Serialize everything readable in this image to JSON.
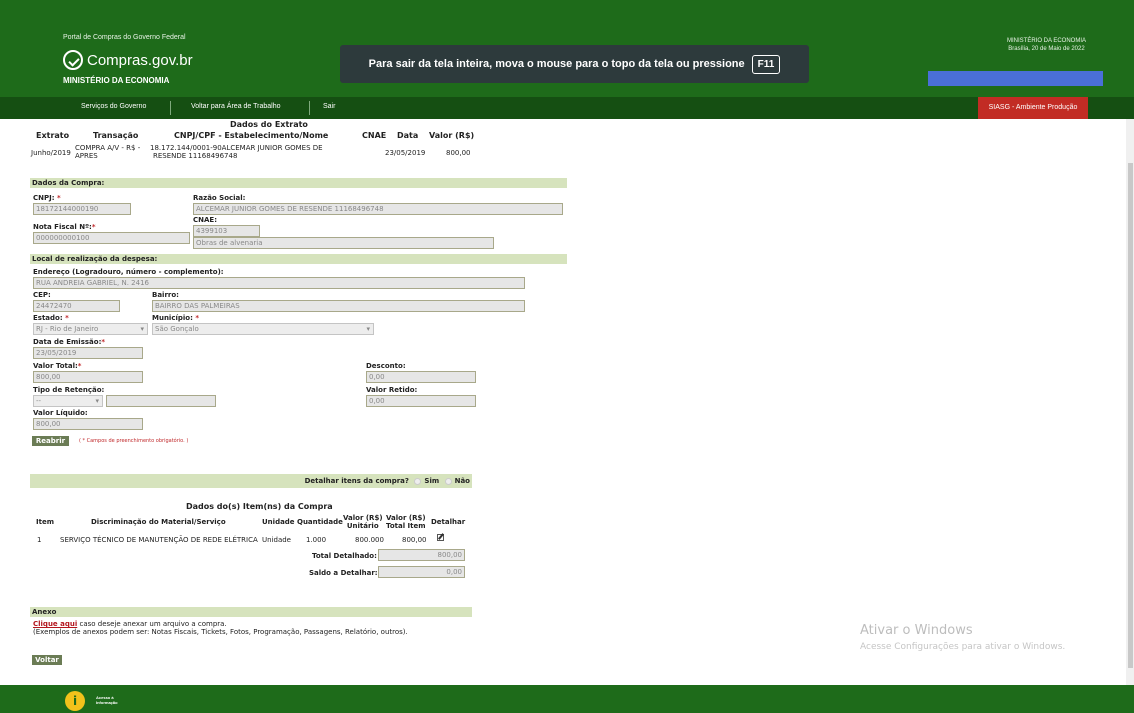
{
  "header": {
    "portal": "Portal de Compras do Governo Federal",
    "logo": "Compras.gov.br",
    "ministerio": "MINISTÉRIO DA ECONOMIA",
    "right_line1": "MINISTÉRIO DA ECONOMIA",
    "right_line2": "Brasília, 20 de Maio de 2022",
    "fullscreen_msg": "Para sair da tela inteira, mova o mouse para o topo da tela ou pressione",
    "fullscreen_key": "F11"
  },
  "nav": {
    "servicos": "Serviços do Governo",
    "voltar_area": "Voltar para Área de Trabalho",
    "sair": "Sair",
    "ambiente": "SIASG - Ambiente Produção"
  },
  "extrato": {
    "title": "Dados do Extrato",
    "headers": [
      "Extrato",
      "Transação",
      "CNPJ/CPF - Estabelecimento/Nome",
      "CNAE",
      "Data",
      "Valor (R$)"
    ],
    "extrato": "Junho/2019",
    "transacao_1": "COMPRA A/V - R$ -",
    "transacao_2": "APRES",
    "cnpj_nome_1": "18.172.144/0001-90ALCEMAR JUNIOR GOMES DE",
    "cnpj_nome_2": "RESENDE 11168496748",
    "data": "23/05/2019",
    "valor": "800,00"
  },
  "compra": {
    "section": "Dados da Compra:",
    "cnpj_label": "CNPJ:",
    "cnpj": "18172144000190",
    "razao_label": "Razão Social:",
    "razao": "ALCEMAR JUNIOR GOMES DE RESENDE 11168496748",
    "cnae_label": "CNAE:",
    "cnae_code": "4399103",
    "cnae_desc": "Obras de alvenaria",
    "nf_label": "Nota Fiscal Nº:",
    "nf": "000000000100"
  },
  "local": {
    "section": "Local de realização da despesa:",
    "endereco_label": "Endereço (Logradouro, número - complemento):",
    "endereco": "RUA ANDREIA GABRIEL, N. 2416",
    "cep_label": "CEP:",
    "cep": "24472470",
    "bairro_label": "Bairro:",
    "bairro": "BAIRRO DAS PALMEIRAS",
    "estado_label": "Estado:",
    "estado": "RJ - Rio de Janeiro",
    "municipio_label": "Município:",
    "municipio": "São Gonçalo",
    "emissao_label": "Data de Emissão:",
    "emissao": "23/05/2019",
    "valor_total_label": "Valor Total:",
    "valor_total": "800,00",
    "desconto_label": "Desconto:",
    "desconto": "0,00",
    "retencao_label": "Tipo de Retenção:",
    "retencao": "--",
    "valor_retido_label": "Valor Retido:",
    "valor_retido": "0,00",
    "valor_liquido_label": "Valor Líquido:",
    "valor_liquido": "800,00",
    "reabrir": "Reabrir",
    "obrigatorio_note": "( * Campos de preenchimento obrigatório. )"
  },
  "detalhar": {
    "question": "Detalhar itens da compra?",
    "sim": "Sim",
    "nao": "Não"
  },
  "itens": {
    "title": "Dados do(s) Item(ns) da Compra",
    "headers": [
      "Item",
      "Discriminação do Material/Serviço",
      "Unidade",
      "Quantidade",
      "Valor (R$) Unitário",
      "Valor (R$) Total Item",
      "Detalhar"
    ],
    "h_valor": "Valor (R$)",
    "h_unitario": "Unitário",
    "h_total_item": "Total Item",
    "row": {
      "item": "1",
      "descricao": "SERVIÇO TÉCNICO DE MANUTENÇÃO DE REDE ELÉTRICA",
      "unidade": "Unidade",
      "quantidade": "1.000",
      "unitario": "800.000",
      "total": "800,00"
    },
    "total_detalhado_label": "Total Detalhado:",
    "total_detalhado": "800,00",
    "saldo_label": "Saldo a Detalhar:",
    "saldo": "0,00"
  },
  "anexo": {
    "section": "Anexo",
    "link": "Clique aqui",
    "text": "caso deseje anexar um arquivo a compra.",
    "examples": "(Exemplos de anexos podem ser: Notas Fiscais, Tickets, Fotos, Programação, Passagens, Relatório, outros).",
    "voltar": "Voltar"
  },
  "watermark": {
    "line1": "Ativar o Windows",
    "line2": "Acesse Configurações para ativar o Windows."
  },
  "footer": {
    "acesso_1": "Acesso à",
    "acesso_2": "Informação"
  }
}
